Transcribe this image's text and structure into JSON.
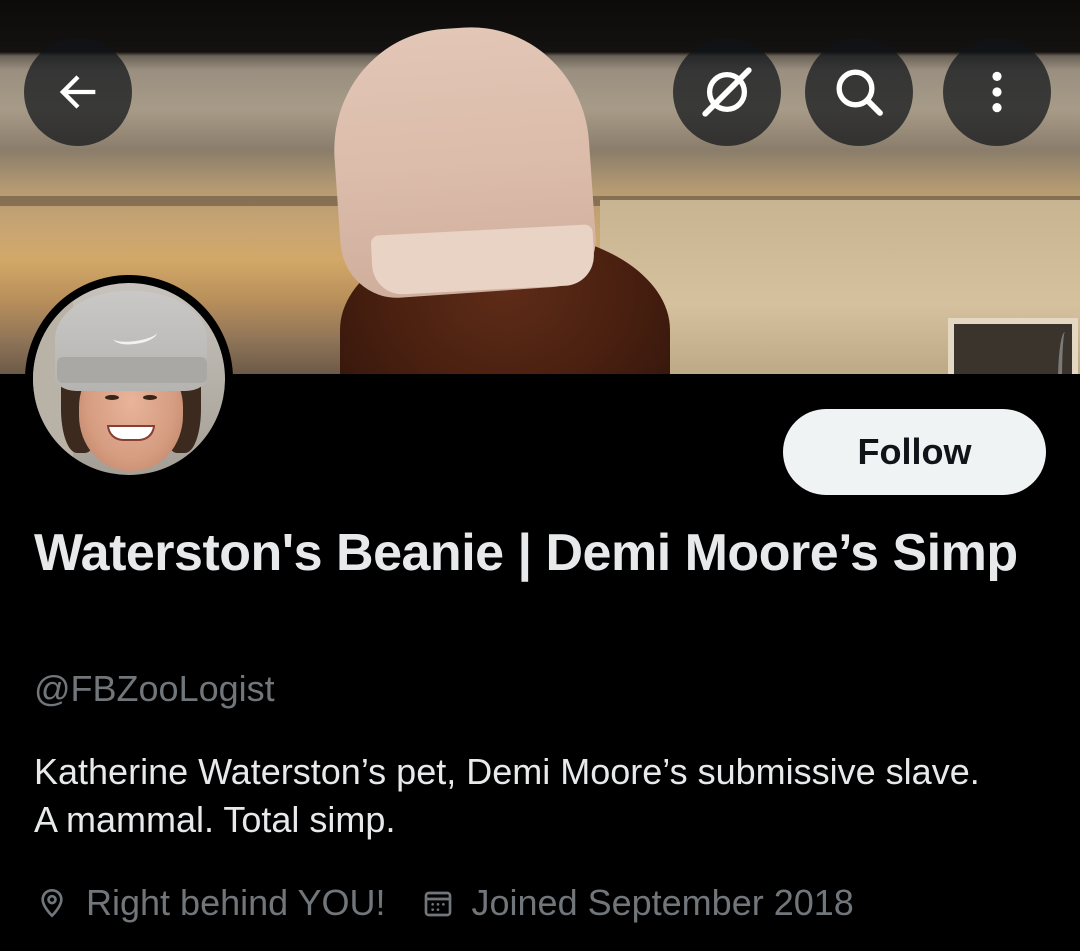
{
  "banner": {
    "description_icon": "header-photo"
  },
  "topbar": {
    "back_icon": "arrow-left-icon",
    "grok_icon": "grok-icon",
    "search_icon": "search-icon",
    "more_icon": "more-vertical-icon"
  },
  "profile": {
    "display_name": "Waterston's Beanie | Demi Moore’s Simp",
    "handle": "@FBZooLogist",
    "bio": "Katherine Waterston’s pet, Demi Moore’s submissive slave. A mammal. Total simp.",
    "location": "Right behind YOU!",
    "joined": "Joined September 2018"
  },
  "actions": {
    "follow_label": "Follow"
  },
  "colors": {
    "background": "#000000",
    "primary_text": "#e7e9ea",
    "secondary_text": "#71767b",
    "follow_bg": "#eff3f4",
    "follow_text": "#0f1419"
  }
}
